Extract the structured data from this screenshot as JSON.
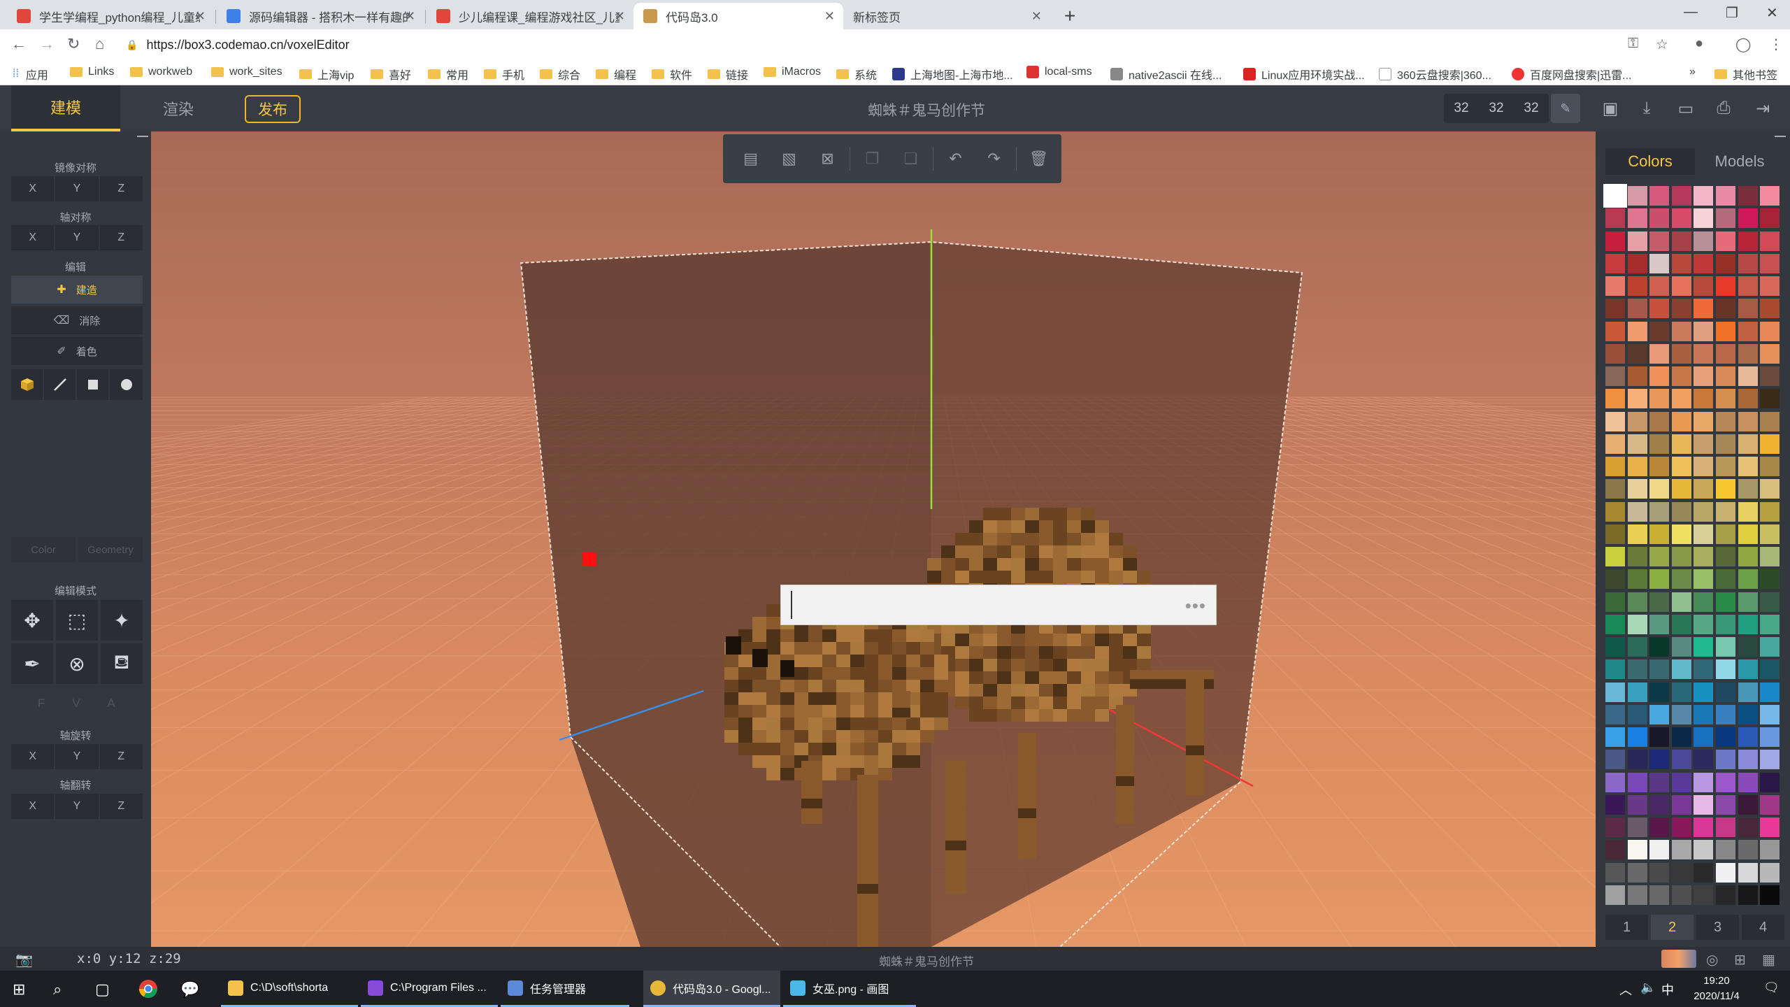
{
  "browser": {
    "tabs": [
      {
        "title": "学生学编程_python编程_儿童编",
        "favicon_color": "#e0463a"
      },
      {
        "title": "源码编辑器 - 搭积木一样有趣的",
        "favicon_color": "#3c80e8"
      },
      {
        "title": "少儿编程课_编程游戏社区_儿童",
        "favicon_color": "#e0463a"
      },
      {
        "title": "代码岛3.0",
        "favicon_color": "#c99a4c",
        "active": true
      },
      {
        "title": "新标签页",
        "favicon_color": ""
      }
    ],
    "new_tab_icon": "plus-icon",
    "url": "https://box3.codemao.cn/voxelEditor",
    "bookmarks": [
      {
        "label": "应用",
        "kind": "apps"
      },
      {
        "label": "Links",
        "kind": "folder"
      },
      {
        "label": "workweb",
        "kind": "folder"
      },
      {
        "label": "work_sites",
        "kind": "folder"
      },
      {
        "label": "上海vip",
        "kind": "folder"
      },
      {
        "label": "喜好",
        "kind": "folder"
      },
      {
        "label": "常用",
        "kind": "folder"
      },
      {
        "label": "手机",
        "kind": "folder"
      },
      {
        "label": "综合",
        "kind": "folder"
      },
      {
        "label": "编程",
        "kind": "folder"
      },
      {
        "label": "软件",
        "kind": "folder"
      },
      {
        "label": "链接",
        "kind": "folder"
      },
      {
        "label": "iMacros",
        "kind": "folder"
      },
      {
        "label": "系统",
        "kind": "folder"
      },
      {
        "label": "上海地图-上海市地...",
        "kind": "site",
        "color": "#2d3a8c"
      },
      {
        "label": "local-sms",
        "kind": "site",
        "color": "#d33"
      },
      {
        "label": "native2ascii 在线...",
        "kind": "site",
        "color": "#888"
      },
      {
        "label": "Linux应用环境实战...",
        "kind": "site",
        "color": "#d22"
      },
      {
        "label": "360云盘搜索|360...",
        "kind": "site",
        "color": "#bbb"
      },
      {
        "label": "百度网盘搜索|迅雷...",
        "kind": "site",
        "color": "#e33"
      }
    ],
    "bookmarks_more": "»",
    "other_bookmarks": "其他书签"
  },
  "app": {
    "tab_build": "建模",
    "tab_render": "渲染",
    "tab_publish": "发布",
    "project_title": "蜘蛛＃鬼马创作节",
    "dims": [
      "32",
      "32",
      "32"
    ]
  },
  "left": {
    "mirror_title": "镜像对称",
    "axis_sym_title": "轴对称",
    "edit_title": "编辑",
    "edit_build": "建造",
    "edit_erase": "消除",
    "edit_paint": "着色",
    "color_label": "Color",
    "geometry_label": "Geometry",
    "edit_mode_title": "编辑模式",
    "fva": [
      "F",
      "V",
      "A"
    ],
    "rotate_title": "轴旋转",
    "flip_title": "轴翻转",
    "axes": [
      "X",
      "Y",
      "Z"
    ]
  },
  "right": {
    "tab_colors": "Colors",
    "tab_models": "Models",
    "pages": [
      "1",
      "2",
      "3",
      "4"
    ],
    "active_page": "2",
    "palette": [
      "#ffffff",
      "#d99aa8",
      "#d45c7a",
      "#b33a5b",
      "#f2b6c8",
      "#e88aa6",
      "#7a2e3c",
      "#f28aa0",
      "#b83a52",
      "#e07590",
      "#c9506c",
      "#d84a6a",
      "#f5d3d9",
      "#b46a78",
      "#d11a5a",
      "#a82238",
      "#c81e3c",
      "#e8a0a8",
      "#c65c6a",
      "#a8404a",
      "#b89098",
      "#e86a7a",
      "#b82438",
      "#d24a58",
      "#c83c40",
      "#a82c2c",
      "#d8c8c8",
      "#b8483a",
      "#c03838",
      "#983028",
      "#b84848",
      "#c85050",
      "#e87a6c",
      "#c04030",
      "#d06050",
      "#e8705c",
      "#b84a3a",
      "#e83a28",
      "#c85a4a",
      "#d8685a",
      "#7a3428",
      "#a8584a",
      "#c8503c",
      "#8a4030",
      "#f06a38",
      "#6a3428",
      "#a85a42",
      "#a84a30",
      "#c85a3a",
      "#f09a70",
      "#6a3a2c",
      "#c87a5a",
      "#e0a080",
      "#f07028",
      "#c06040",
      "#e88858",
      "#9a5038",
      "#5a3a2c",
      "#e89a78",
      "#a86040",
      "#c87858",
      "#b86848",
      "#a86a48",
      "#e8905a",
      "#8a6858",
      "#a85a30",
      "#f0905a",
      "#c87848",
      "#e8a078",
      "#d88a58",
      "#e8b898",
      "#6a4a3a",
      "#f09040",
      "#f8b078",
      "#e8985a",
      "#f0a060",
      "#c87838",
      "#d89050",
      "#a86838",
      "#3a2a18",
      "#f0c098",
      "#c89868",
      "#a87848",
      "#e89850",
      "#e8a868",
      "#b88858",
      "#c89060",
      "#a88050",
      "#e8b070",
      "#d8b888",
      "#a08048",
      "#e8b858",
      "#c8a070",
      "#a88858",
      "#d8b070",
      "#f0b030",
      "#d8a030",
      "#e8b048",
      "#b88838",
      "#f0c058",
      "#d8b078",
      "#b89858",
      "#e8c078",
      "#a88848",
      "#8a7848",
      "#e8d098",
      "#f0d888",
      "#e8b838",
      "#c8a858",
      "#f8c830",
      "#a89868",
      "#d8c080",
      "#a88830",
      "#c8b898",
      "#a8a078",
      "#988858",
      "#b8a868",
      "#c8b070",
      "#e8d060",
      "#b8a040",
      "#7a6a28",
      "#e8d050",
      "#c8b030",
      "#f0e060",
      "#d8d098",
      "#a8a048",
      "#e0d040",
      "#c8c060",
      "#c8d040",
      "#6a7a38",
      "#98a848",
      "#8a9a48",
      "#a8b060",
      "#586838",
      "#90a840",
      "#a8b878",
      "#3a4a2a",
      "#5a7a38",
      "#8ab040",
      "#6a8a48",
      "#98c068",
      "#4a6a38",
      "#6aa048",
      "#2a4a28",
      "#3a6a38",
      "#5a8a58",
      "#4a6a48",
      "#90c090",
      "#488a58",
      "#2a8a48",
      "#5a9a68",
      "#3a5a48",
      "#188a58",
      "#a8d8b8",
      "#5a9a80",
      "#287858",
      "#58a888",
      "#389878",
      "#20a080",
      "#48a888",
      "#105848",
      "#2a6a58",
      "#083828",
      "#588a80",
      "#20b890",
      "#78c8b0",
      "#2a4a40",
      "#48a8a0",
      "#208888",
      "#3a6a70",
      "#386870",
      "#60b8c8",
      "#306878",
      "#90d8e8",
      "#2a98a8",
      "#1a5868",
      "#6ab8d8",
      "#3aa0c0",
      "#0a3a48",
      "#286878",
      "#1890c0",
      "#204860",
      "#4a98b8",
      "#1888c8",
      "#3a6888",
      "#2a5a78",
      "#4aa8e0",
      "#5888a8",
      "#1a78b8",
      "#3a80c0",
      "#0a5080",
      "#78b8e8",
      "#3aa0e8",
      "#1880e0",
      "#181828",
      "#0a2848",
      "#1870c0",
      "#0a3880",
      "#2a5ab8",
      "#6a98e0",
      "#4a5888",
      "#282858",
      "#1a2a78",
      "#4a4898",
      "#2a2a60",
      "#6a78c8",
      "#8a8ad8",
      "#a0a8e8",
      "#8a68c8",
      "#7a48b8",
      "#5a3888",
      "#5a3a98",
      "#b898e0",
      "#9a58c8",
      "#8a4ab8",
      "#2a1848",
      "#3a1858",
      "#6a3888",
      "#4a2868",
      "#7a3898",
      "#e8b8e8",
      "#8a48a8",
      "#3a1838",
      "#a03888",
      "#5a2a48",
      "#6a5a68",
      "#5a1848",
      "#881858",
      "#d83898",
      "#c83888",
      "#482838",
      "#e83898",
      "#4a2838",
      "#f8f8f0",
      "#f0f0f0",
      "#a8a8a8",
      "#c8c8c8",
      "#888888",
      "#6a6a6a",
      "#989898",
      "#585858",
      "#686868",
      "#4a4a4a",
      "#383838",
      "#2a2a2a",
      "#f0f0f0",
      "#d8d8d8",
      "#b8b8b8",
      "#a0a0a0",
      "#787878",
      "#686868",
      "#505050",
      "#404040",
      "#282828",
      "#181818",
      "#0a0a0a"
    ],
    "selected_swatch": 0
  },
  "status": {
    "coords": "x:0  y:12  z:29",
    "title": "蜘蛛＃鬼马创作节"
  },
  "cmd": {
    "dots": "•••"
  },
  "taskbar": {
    "apps": [
      {
        "label": "C:\\D\\soft\\shorta",
        "color": "#f2c24a"
      },
      {
        "label": "C:\\Program Files ...",
        "color": "#8a4ad8"
      },
      {
        "label": "任务管理器",
        "color": "#5a8ad8"
      },
      {
        "label": "代码岛3.0 - Googl...",
        "color": "#e8b838",
        "active": true
      },
      {
        "label": "女巫.png - 画图",
        "color": "#4ab8e8"
      }
    ],
    "time": "19:20",
    "date": "2020/11/4",
    "ime": "中"
  }
}
